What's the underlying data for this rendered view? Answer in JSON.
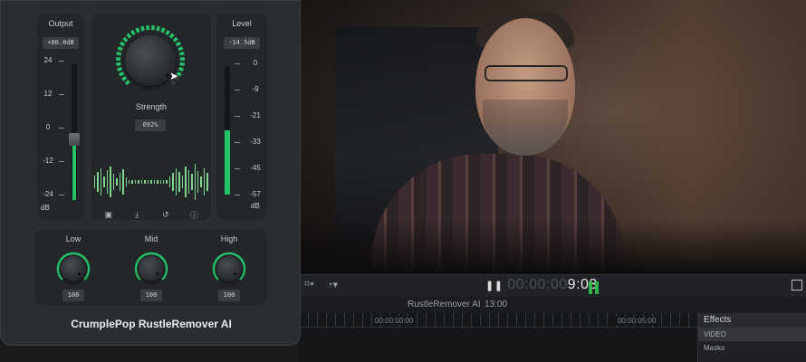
{
  "plugin": {
    "brand": "CrumplePop RustleRemover AI",
    "output": {
      "label": "Output",
      "value": "+00.0dB",
      "scale": [
        "24",
        "12",
        "0",
        "-12",
        "-24"
      ],
      "unit": "dB",
      "level": 0.45
    },
    "strength": {
      "label": "Strength",
      "value": "092%",
      "level": 0.92
    },
    "level": {
      "label": "Level",
      "value": "-14.5dB",
      "scale": [
        "0",
        "-9",
        "-21",
        "-33",
        "-45",
        "-57"
      ],
      "unit": "dB",
      "level": 0.5
    },
    "eq": [
      {
        "label": "Low",
        "value": "100"
      },
      {
        "label": "Mid",
        "value": "100"
      },
      {
        "label": "High",
        "value": "100"
      }
    ],
    "toolbar_icons": [
      "save-icon",
      "download-icon",
      "undo-icon",
      "info-icon"
    ]
  },
  "timeline": {
    "timecode_dim": "00:00:00",
    "timecode": "9:03",
    "clip_name": "RustleRemover AI",
    "clip_duration": "13:00",
    "ruler_start": "00:00:00:00",
    "ruler_end": "00:00:05:00"
  },
  "effects": {
    "header": "Effects",
    "items": [
      "VIDEO",
      "Masks"
    ]
  },
  "colors": {
    "accent": "#24c36a",
    "panel": "#2b2e31"
  }
}
